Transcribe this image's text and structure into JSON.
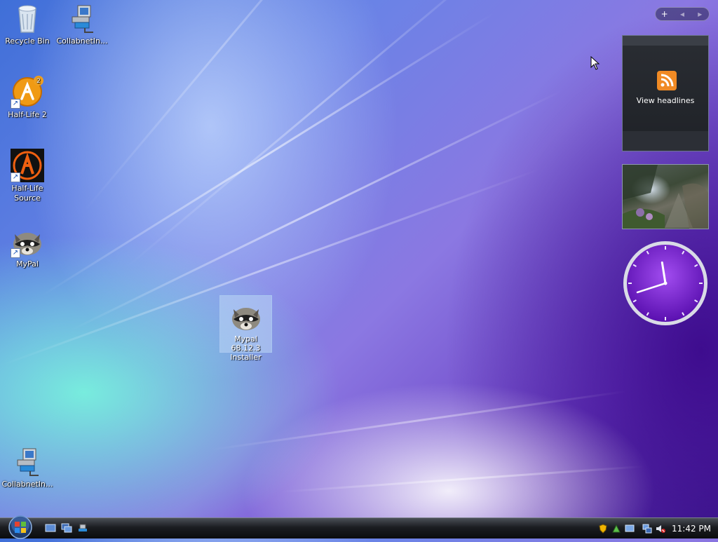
{
  "desktop": {
    "icons": [
      {
        "label": "Recycle Bin",
        "icon": "recycle-bin-icon"
      },
      {
        "label": "CollabnetIn...",
        "icon": "network-computer-icon"
      },
      {
        "label": "Half-Life 2",
        "icon": "half-life-2-icon"
      },
      {
        "label": "Half-Life Source",
        "icon": "half-life-source-icon"
      },
      {
        "label": "MyPal",
        "icon": "raccoon-icon"
      },
      {
        "label": "CollabnetIn...",
        "icon": "network-computer-icon"
      },
      {
        "label": "Mypal 68.12.3 Installer",
        "icon": "raccoon-icon"
      }
    ]
  },
  "sidebar": {
    "controls": {
      "add": "+",
      "prev": "◂",
      "next": "▸"
    },
    "feed": {
      "label": "View headlines",
      "icon": "rss-feed-icon"
    },
    "clock": {
      "hour": 11,
      "minute": 42
    }
  },
  "taskbar": {
    "time": "11:42 PM",
    "quick_launch": [
      "show-desktop-icon",
      "switch-windows-icon",
      "network-icon"
    ],
    "tray": [
      "security-shield-icon",
      "network-status-icon",
      "display-icon",
      "network-connection-icon",
      "volume-muted-icon"
    ]
  },
  "colors": {
    "accent_purple": "#7a22d6",
    "rss_orange": "#f08a24"
  }
}
